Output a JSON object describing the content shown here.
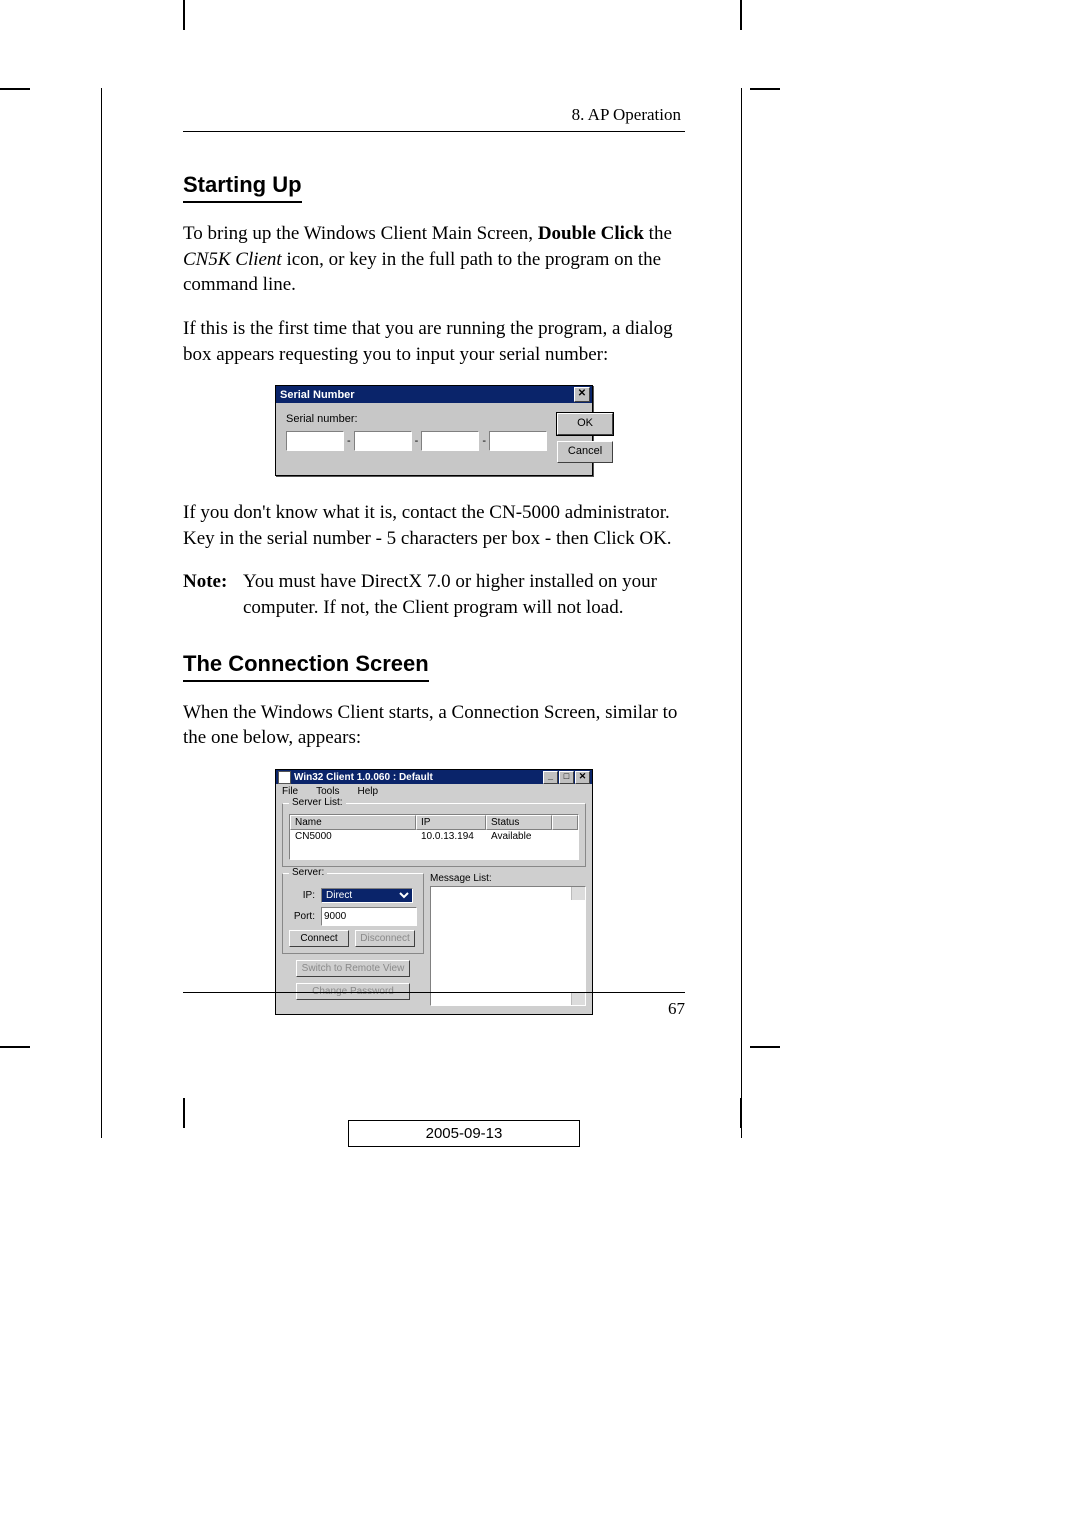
{
  "header": {
    "running_head": "8. AP Operation"
  },
  "sections": {
    "starting_up": {
      "title": "Starting Up",
      "p1_a": "To bring up the Windows Client Main Screen, ",
      "p1_bold": "Double Click",
      "p1_b": " the ",
      "p1_italic": "CN5K Client",
      "p1_c": " icon, or key in the full path to the program on the command line.",
      "p2": "If this is the first time that you are running the program, a dialog box appears requesting you to input your serial number:",
      "p3": "If you don't know what it is, contact the CN-5000 administrator. Key in the serial number - 5 characters per box - then Click OK.",
      "note_label": "Note:",
      "note_text": "You must have DirectX 7.0 or higher installed on your computer. If not, the Client program will not load."
    },
    "connection": {
      "title": "The Connection Screen",
      "p1": "When the Windows Client starts, a Connection Screen, similar to the one below, appears:"
    }
  },
  "serial_dialog": {
    "title": "Serial Number",
    "label": "Serial number:",
    "dash": "-",
    "ok": "OK",
    "cancel": "Cancel",
    "close_glyph": "✕"
  },
  "conn_window": {
    "title": "Win32 Client 1.0.060 : Default",
    "min_glyph": "_",
    "max_glyph": "□",
    "close_glyph": "✕",
    "menu": {
      "file": "File",
      "tools": "Tools",
      "help": "Help"
    },
    "server_list": {
      "group_title": "Server List:",
      "cols": {
        "name": "Name",
        "ip": "IP",
        "status": "Status"
      },
      "rows": [
        {
          "name": "CN5000",
          "ip": "10.0.13.194",
          "status": "Available"
        }
      ]
    },
    "server": {
      "group_title": "Server:",
      "ip_label": "IP:",
      "ip_value": "Direct",
      "port_label": "Port:",
      "port_value": "9000",
      "connect": "Connect",
      "disconnect": "Disconnect",
      "switch_remote": "Switch to Remote View",
      "change_pw": "Change Password"
    },
    "message_list_label": "Message List:"
  },
  "footer": {
    "page_number": "67",
    "date": "2005-09-13"
  }
}
